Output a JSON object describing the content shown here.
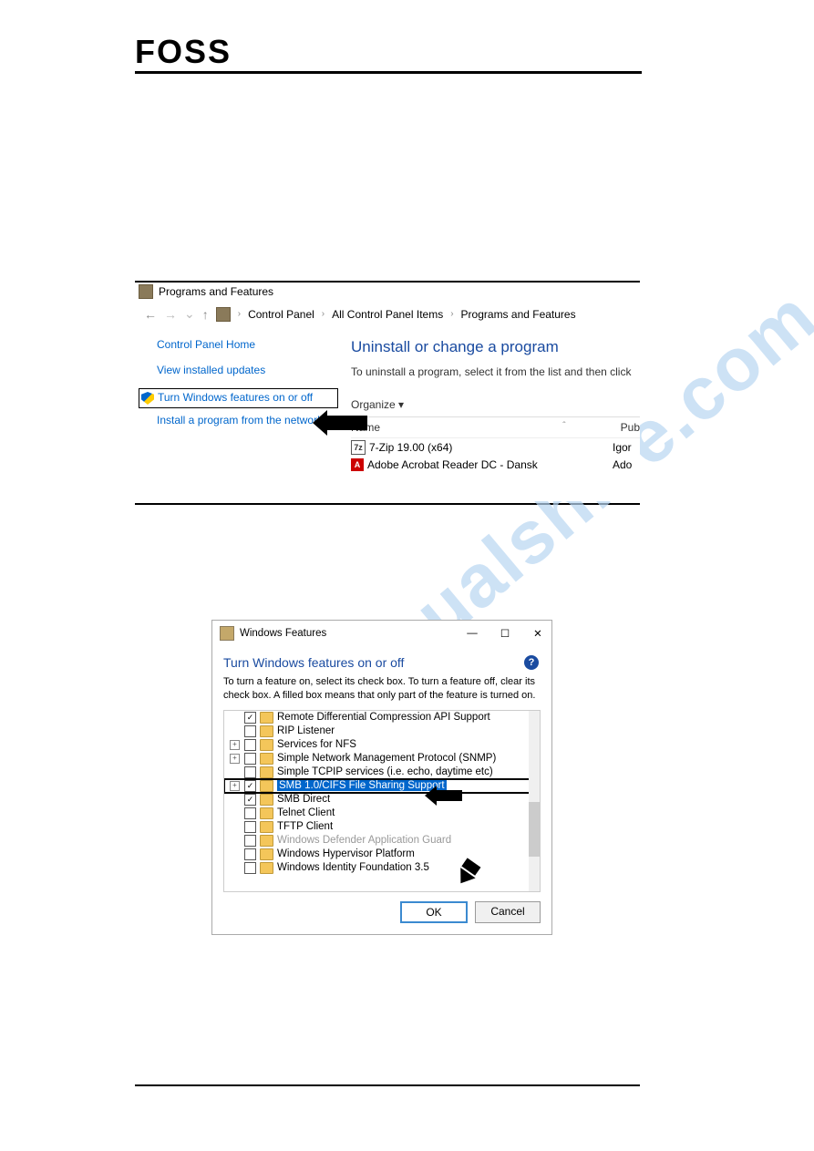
{
  "header": {
    "logo": "FOSS"
  },
  "watermark": "manualshive.com",
  "win1": {
    "title": "Programs and Features",
    "breadcrumbs": [
      "Control Panel",
      "All Control Panel Items",
      "Programs and Features"
    ],
    "sidebar": {
      "home": "Control Panel Home",
      "links": [
        "View installed updates",
        "Turn Windows features on or off",
        "Install a program from the network"
      ]
    },
    "main": {
      "heading": "Uninstall or change a program",
      "subtext": "To uninstall a program, select it from the list and then click",
      "toolbar": "Organize ▾",
      "columns": [
        "Name",
        "Pub"
      ],
      "rows": [
        {
          "name": "7-Zip 19.00 (x64)",
          "pub": "Igor",
          "icon": "zip"
        },
        {
          "name": "Adobe Acrobat Reader DC - Dansk",
          "pub": "Ado",
          "icon": "adobe"
        }
      ]
    }
  },
  "win2": {
    "title": "Windows Features",
    "heading": "Turn Windows features on or off",
    "description": "To turn a feature on, select its check box. To turn a feature off, clear its check box. A filled box means that only part of the feature is turned on.",
    "features": [
      {
        "label": "Remote Differential Compression API Support",
        "checked": true
      },
      {
        "label": "RIP Listener",
        "checked": false
      },
      {
        "label": "Services for NFS",
        "checked": false,
        "expandable": true
      },
      {
        "label": "Simple Network Management Protocol (SNMP)",
        "checked": false,
        "expandable": true
      },
      {
        "label": "Simple TCPIP services (i.e. echo, daytime etc)",
        "checked": false
      },
      {
        "label": "SMB 1.0/CIFS File Sharing Support",
        "checked": true,
        "expandable": true,
        "selected": true
      },
      {
        "label": "SMB Direct",
        "checked": true
      },
      {
        "label": "Telnet Client",
        "checked": false
      },
      {
        "label": "TFTP Client",
        "checked": false
      },
      {
        "label": "Windows Defender Application Guard",
        "checked": false,
        "dimmed": true
      },
      {
        "label": "Windows Hypervisor Platform",
        "checked": false
      },
      {
        "label": "Windows Identity Foundation 3.5",
        "checked": false
      }
    ],
    "buttons": {
      "ok": "OK",
      "cancel": "Cancel"
    }
  }
}
